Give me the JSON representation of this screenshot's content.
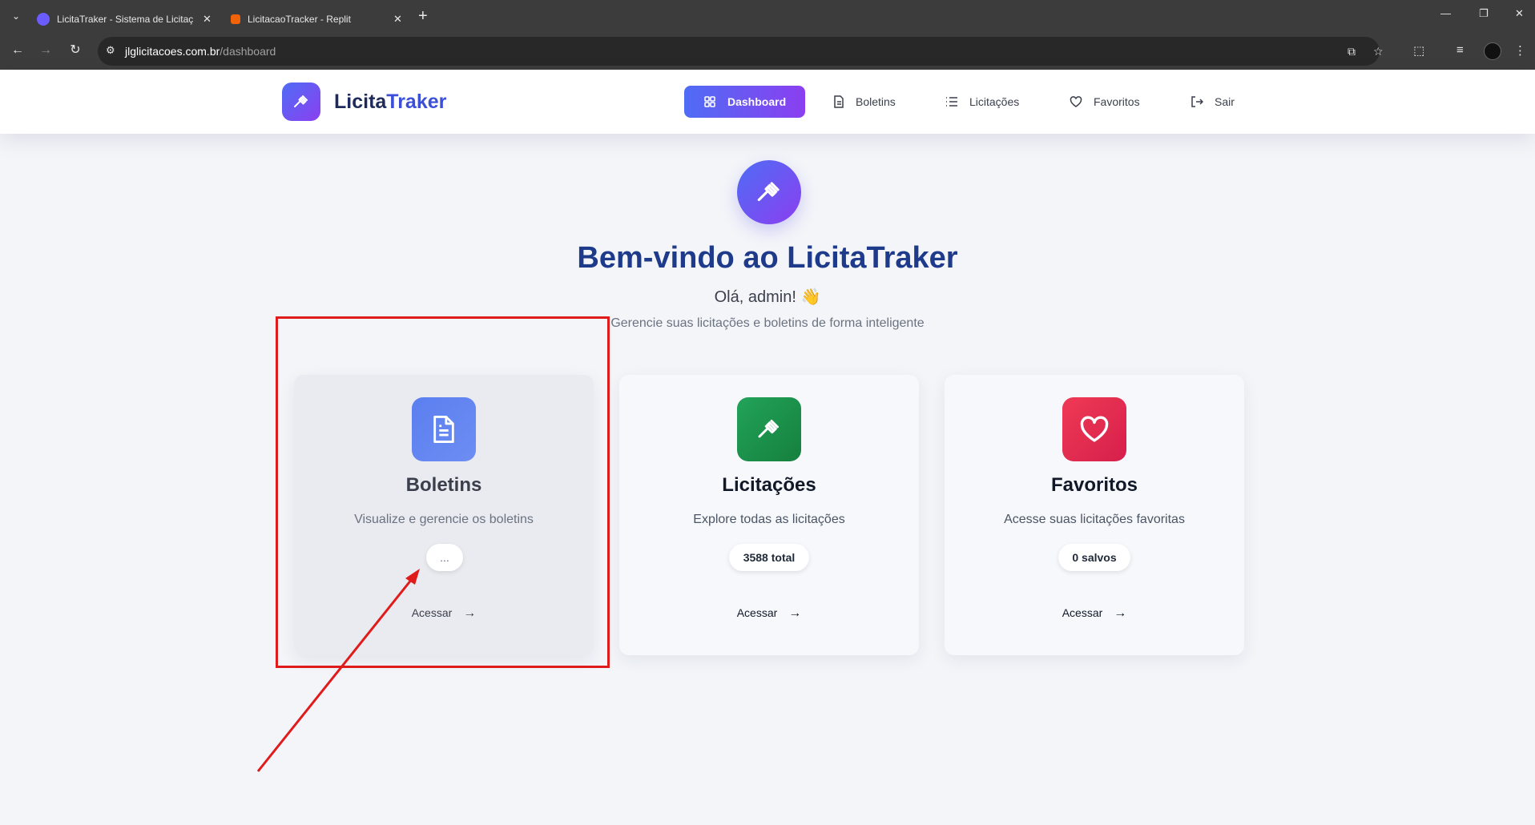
{
  "browser": {
    "tabs": [
      {
        "title": "LicitaTraker - Sistema de Licitaç",
        "favicon_color": "#6b5cff"
      },
      {
        "title": "LicitacaoTracker - Replit",
        "favicon_color": "#f26207"
      }
    ],
    "url_host": "jlglicitacoes.com.br",
    "url_path": "/dashboard"
  },
  "header": {
    "brand_part1": "Licita",
    "brand_part2": "Traker",
    "nav": {
      "dashboard": "Dashboard",
      "boletins": "Boletins",
      "licitacoes": "Licitações",
      "favoritos": "Favoritos",
      "sair": "Sair"
    }
  },
  "hero": {
    "title": "Bem-vindo ao LicitaTraker",
    "greeting": "Olá, admin! 👋",
    "subtitle": "Gerencie suas licitações e boletins de forma inteligente"
  },
  "cards": [
    {
      "title": "Boletins",
      "description": "Visualize e gerencie os boletins",
      "badge": "...",
      "link": "Acessar",
      "arrow": "→",
      "icon": "document-icon",
      "color": "#5b7ff0"
    },
    {
      "title": "Licitações",
      "description": "Explore todas as licitações",
      "badge": "3588 total",
      "link": "Acessar",
      "arrow": "→",
      "icon": "gavel-icon",
      "color": "#16a34a"
    },
    {
      "title": "Favoritos",
      "description": "Acesse suas licitações favoritas",
      "badge": "0 salvos",
      "link": "Acessar",
      "arrow": "→",
      "icon": "heart-icon",
      "color": "#e11d48"
    }
  ],
  "colors": {
    "brand_gradient_start": "#4f6cf5",
    "brand_gradient_end": "#8b3ff0",
    "title": "#1e3a8a",
    "annotation": "#e01b1b"
  }
}
